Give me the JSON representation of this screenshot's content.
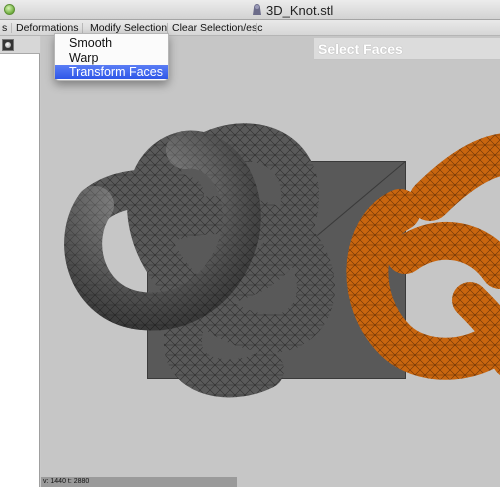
{
  "window": {
    "title": "3D_Knot.stl"
  },
  "menubar": {
    "items": [
      "s",
      "Deformations",
      "Modify Selection",
      "Clear Selection/esc"
    ]
  },
  "dropdown": {
    "items": [
      {
        "label": "Smooth",
        "selected": false
      },
      {
        "label": "Warp",
        "selected": false
      },
      {
        "label": "Transform Faces",
        "selected": true
      }
    ]
  },
  "viewport": {
    "header": "Select Faces"
  },
  "status": {
    "text": "v: 1440  t: 2880"
  },
  "colors": {
    "mesh_gray": "#585858",
    "mesh_orange": "#c6620d",
    "selection_fill": "#595959",
    "menu_highlight": "#2f57e8"
  },
  "icons": [
    "window-close-icon",
    "document-icon",
    "tool-icon"
  ]
}
